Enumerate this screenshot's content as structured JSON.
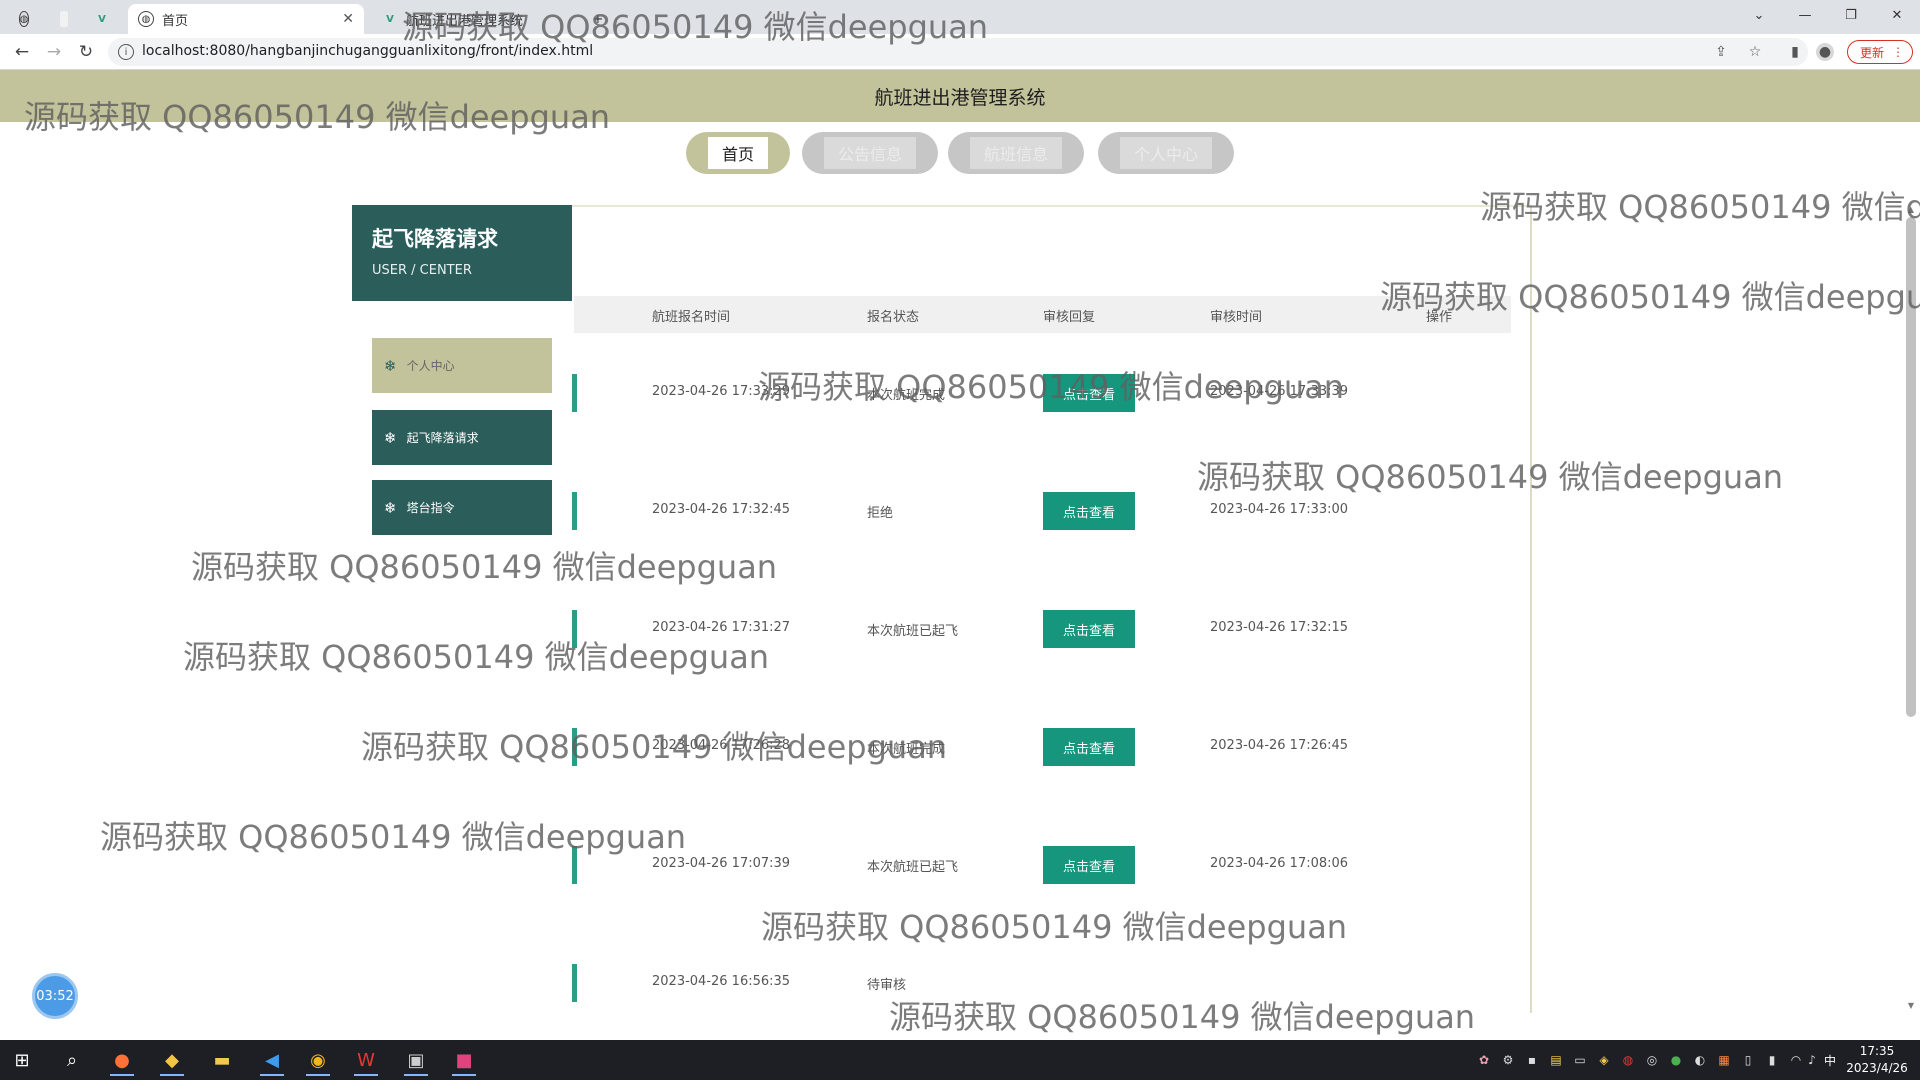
{
  "browser": {
    "tabs": [
      {
        "label": ""
      },
      {
        "label": ""
      },
      {
        "label": ""
      },
      {
        "label": "首页"
      },
      {
        "label": "航班进出港管理系统"
      }
    ],
    "url": "localhost:8080/hangbanjinchugangguanlixitong/front/index.html",
    "update_label": "更新"
  },
  "page": {
    "header_title": "航班进出港管理系统",
    "nav": [
      {
        "label": "首页",
        "active": true
      },
      {
        "label": "公告信息",
        "active": false
      },
      {
        "label": "航班信息",
        "active": false
      },
      {
        "label": "个人中心",
        "active": false
      }
    ]
  },
  "sidebar": {
    "title": "起飞降落请求",
    "subtitle": "USER / CENTER",
    "items": [
      {
        "label": "个人中心"
      },
      {
        "label": "起飞降落请求"
      },
      {
        "label": "塔台指令"
      }
    ]
  },
  "table": {
    "columns": [
      "航班报名时间",
      "报名状态",
      "审核回复",
      "审核时间",
      "操作"
    ],
    "button_label": "点击查看",
    "rows": [
      {
        "time": "2023-04-26 17:33:29",
        "status": "本次航班完成",
        "has_button": true,
        "review_time": "2023-04-26 17:33:39"
      },
      {
        "time": "2023-04-26 17:32:45",
        "status": "拒绝",
        "has_button": true,
        "review_time": "2023-04-26 17:33:00"
      },
      {
        "time": "2023-04-26 17:31:27",
        "status": "本次航班已起飞",
        "has_button": true,
        "review_time": "2023-04-26 17:32:15"
      },
      {
        "time": "2023-04-26 17:26:28",
        "status": "本次航班完成",
        "has_button": true,
        "review_time": "2023-04-26 17:26:45"
      },
      {
        "time": "2023-04-26 17:07:39",
        "status": "本次航班已起飞",
        "has_button": true,
        "review_time": "2023-04-26 17:08:06"
      },
      {
        "time": "2023-04-26 16:56:35",
        "status": "待审核",
        "has_button": false,
        "review_time": ""
      }
    ]
  },
  "timer": "03:52",
  "watermark": "源码获取 QQ86050149 微信deepguan",
  "taskbar": {
    "time": "17:35",
    "date": "2023/4/26",
    "ime": "中"
  },
  "colors": {
    "header_bg": "#c2c39a",
    "sidebar_dark": "#2b5e5a",
    "button_teal": "#17967e"
  }
}
